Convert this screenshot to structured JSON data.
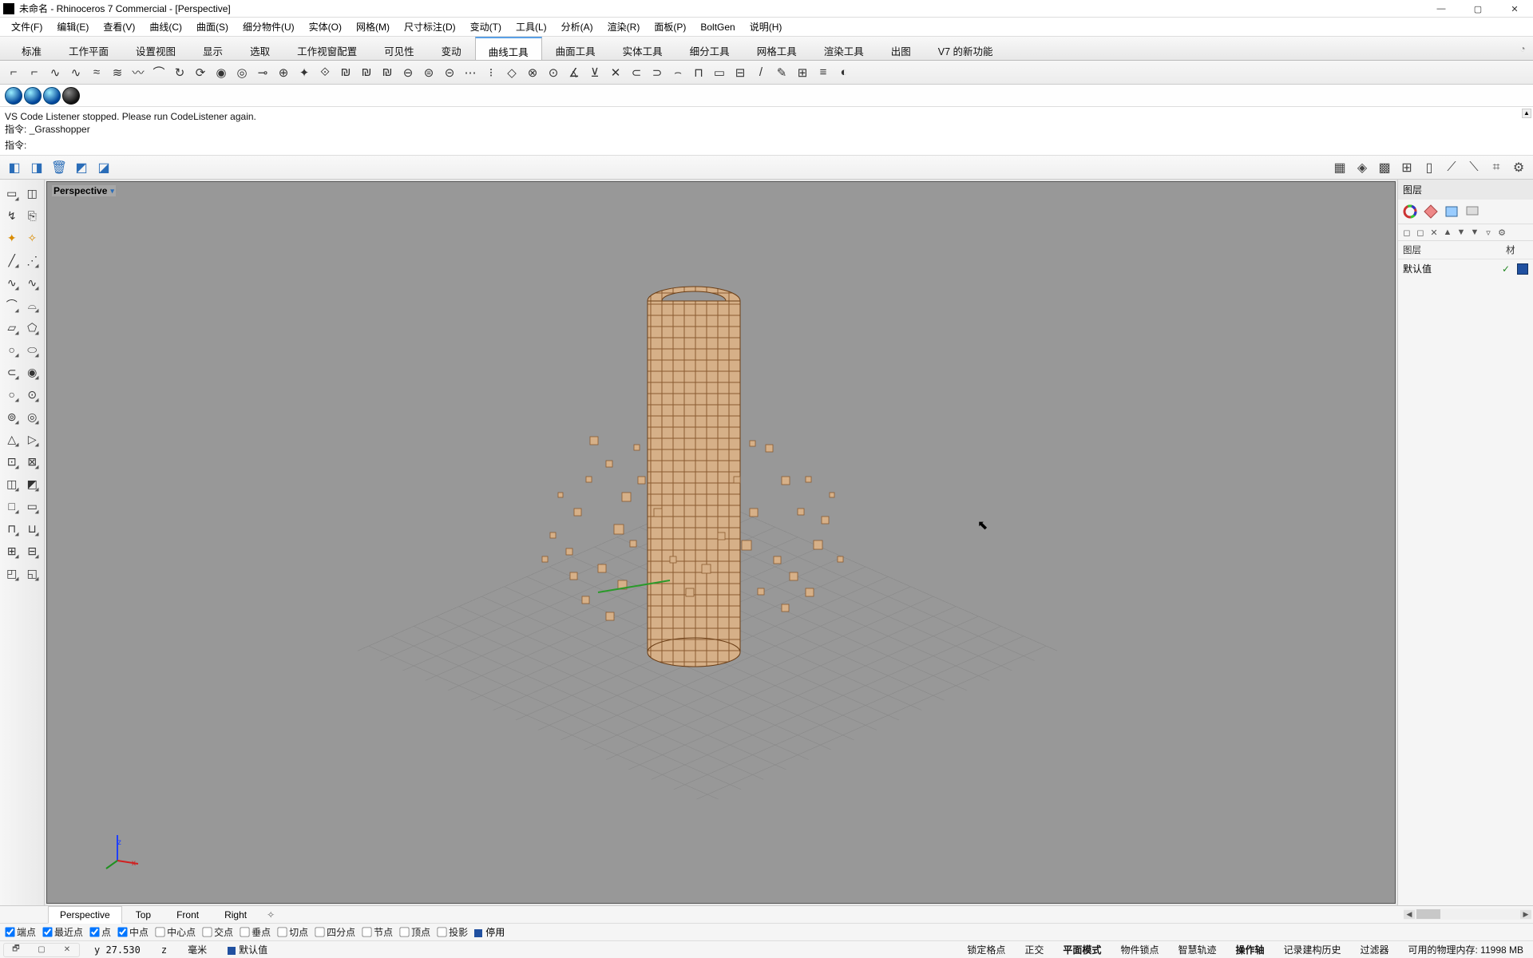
{
  "title": "未命名 - Rhinoceros 7 Commercial - [Perspective]",
  "menu": [
    "文件(F)",
    "编辑(E)",
    "查看(V)",
    "曲线(C)",
    "曲面(S)",
    "细分物件(U)",
    "实体(O)",
    "网格(M)",
    "尺寸标注(D)",
    "变动(T)",
    "工具(L)",
    "分析(A)",
    "渲染(R)",
    "面板(P)",
    "BoltGen",
    "说明(H)"
  ],
  "tabs": {
    "items": [
      "标准",
      "工作平面",
      "设置视图",
      "显示",
      "选取",
      "工作视窗配置",
      "可见性",
      "变动",
      "曲线工具",
      "曲面工具",
      "实体工具",
      "细分工具",
      "网格工具",
      "渲染工具",
      "出图",
      "V7 的新功能"
    ],
    "active_index": 8
  },
  "messages": {
    "line1": "VS Code Listener stopped. Please run CodeListener again.",
    "line2_prefix": "指令:",
    "line2_value": "_Grasshopper",
    "prompt": "指令:",
    "input_value": ""
  },
  "viewport": {
    "title": "Perspective",
    "tabs": [
      "Perspective",
      "Top",
      "Front",
      "Right"
    ],
    "active_tab": 0,
    "plus": "✧"
  },
  "axes": {
    "x": "x",
    "z": "z"
  },
  "layers_panel": {
    "title": "图层",
    "col1": "图层",
    "col2": "材",
    "row_name": "默认值"
  },
  "osnap": {
    "items": [
      "端点",
      "最近点",
      "点",
      "中点",
      "中心点",
      "交点",
      "垂点",
      "切点",
      "四分点",
      "节点",
      "顶点",
      "投影"
    ],
    "checked": [
      true,
      true,
      true,
      true,
      false,
      false,
      false,
      false,
      false,
      false,
      false,
      false
    ],
    "stop_label": "停用"
  },
  "status": {
    "y_label": "y",
    "y_value": "27.530",
    "z_label": "z",
    "units": "毫米",
    "layer": "默认值",
    "items": [
      "锁定格点",
      "正交",
      "平面模式",
      "物件锁点",
      "智慧轨迹",
      "操作轴",
      "记录建构历史",
      "过滤器"
    ],
    "bold_items": [
      "平面模式",
      "操作轴"
    ],
    "memory": "可用的物理内存: 11998 MB"
  }
}
